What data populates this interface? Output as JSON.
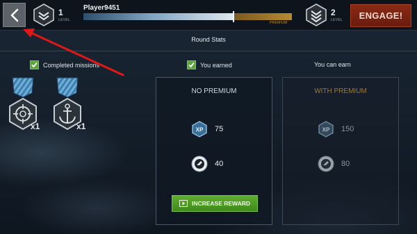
{
  "header": {
    "current_rank": "1",
    "current_rank_label": "LEVEL",
    "next_rank": "2",
    "next_rank_label": "LEVEL",
    "player_name": "Player9451",
    "premium_label": "PREMIUM",
    "engage_label": "ENGAGE!",
    "xp_progress_fraction": 0.72,
    "premium_progress_fraction": 0.28
  },
  "round_stats": {
    "title": "Round Stats",
    "completed_missions_label": "Completed missions",
    "you_earned_label": "You earned",
    "you_can_earn_label": "You can earn"
  },
  "medals": [
    {
      "icon": "crosshair-medal-icon",
      "count": "x1"
    },
    {
      "icon": "anchor-medal-icon",
      "count": "x1"
    }
  ],
  "panels": {
    "no_premium": {
      "title": "NO PREMIUM",
      "xp_value": "75",
      "credits_value": "40",
      "increase_label": "INCREASE REWARD"
    },
    "with_premium": {
      "title": "WITH PREMIUM",
      "xp_value": "150",
      "credits_value": "80"
    }
  },
  "icons": {
    "xp": "XP"
  },
  "colors": {
    "engage": "#7a2412",
    "increase": "#4f9c24",
    "premium_gold": "#c8952e",
    "checkbox_green": "#5aa63a",
    "annotation_red": "#e01818"
  }
}
